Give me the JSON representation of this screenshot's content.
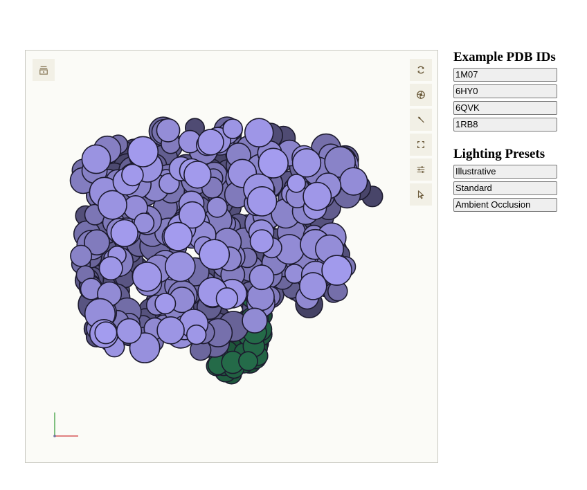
{
  "viewer": {
    "toolbar": {
      "left": [
        {
          "icon": "animation-icon"
        }
      ],
      "right": [
        {
          "icon": "reset-camera-icon"
        },
        {
          "icon": "screenshot-icon"
        },
        {
          "icon": "wrench-icon"
        },
        {
          "icon": "fullscreen-icon"
        },
        {
          "icon": "settings-icon"
        },
        {
          "icon": "selection-mode-icon"
        }
      ]
    },
    "colors": {
      "background": "#fbfbf7",
      "protein": "#7e78b8",
      "ligand": "#2f8a5e",
      "axis_x": "#e57373",
      "axis_y": "#66bb6a"
    }
  },
  "side": {
    "pdb_heading": "Example PDB IDs",
    "pdb_ids": [
      "1M07",
      "6HY0",
      "6QVK",
      "1RB8"
    ],
    "lighting_heading": "Lighting Presets",
    "lighting_presets": [
      "Illustrative",
      "Standard",
      "Ambient Occlusion"
    ]
  }
}
